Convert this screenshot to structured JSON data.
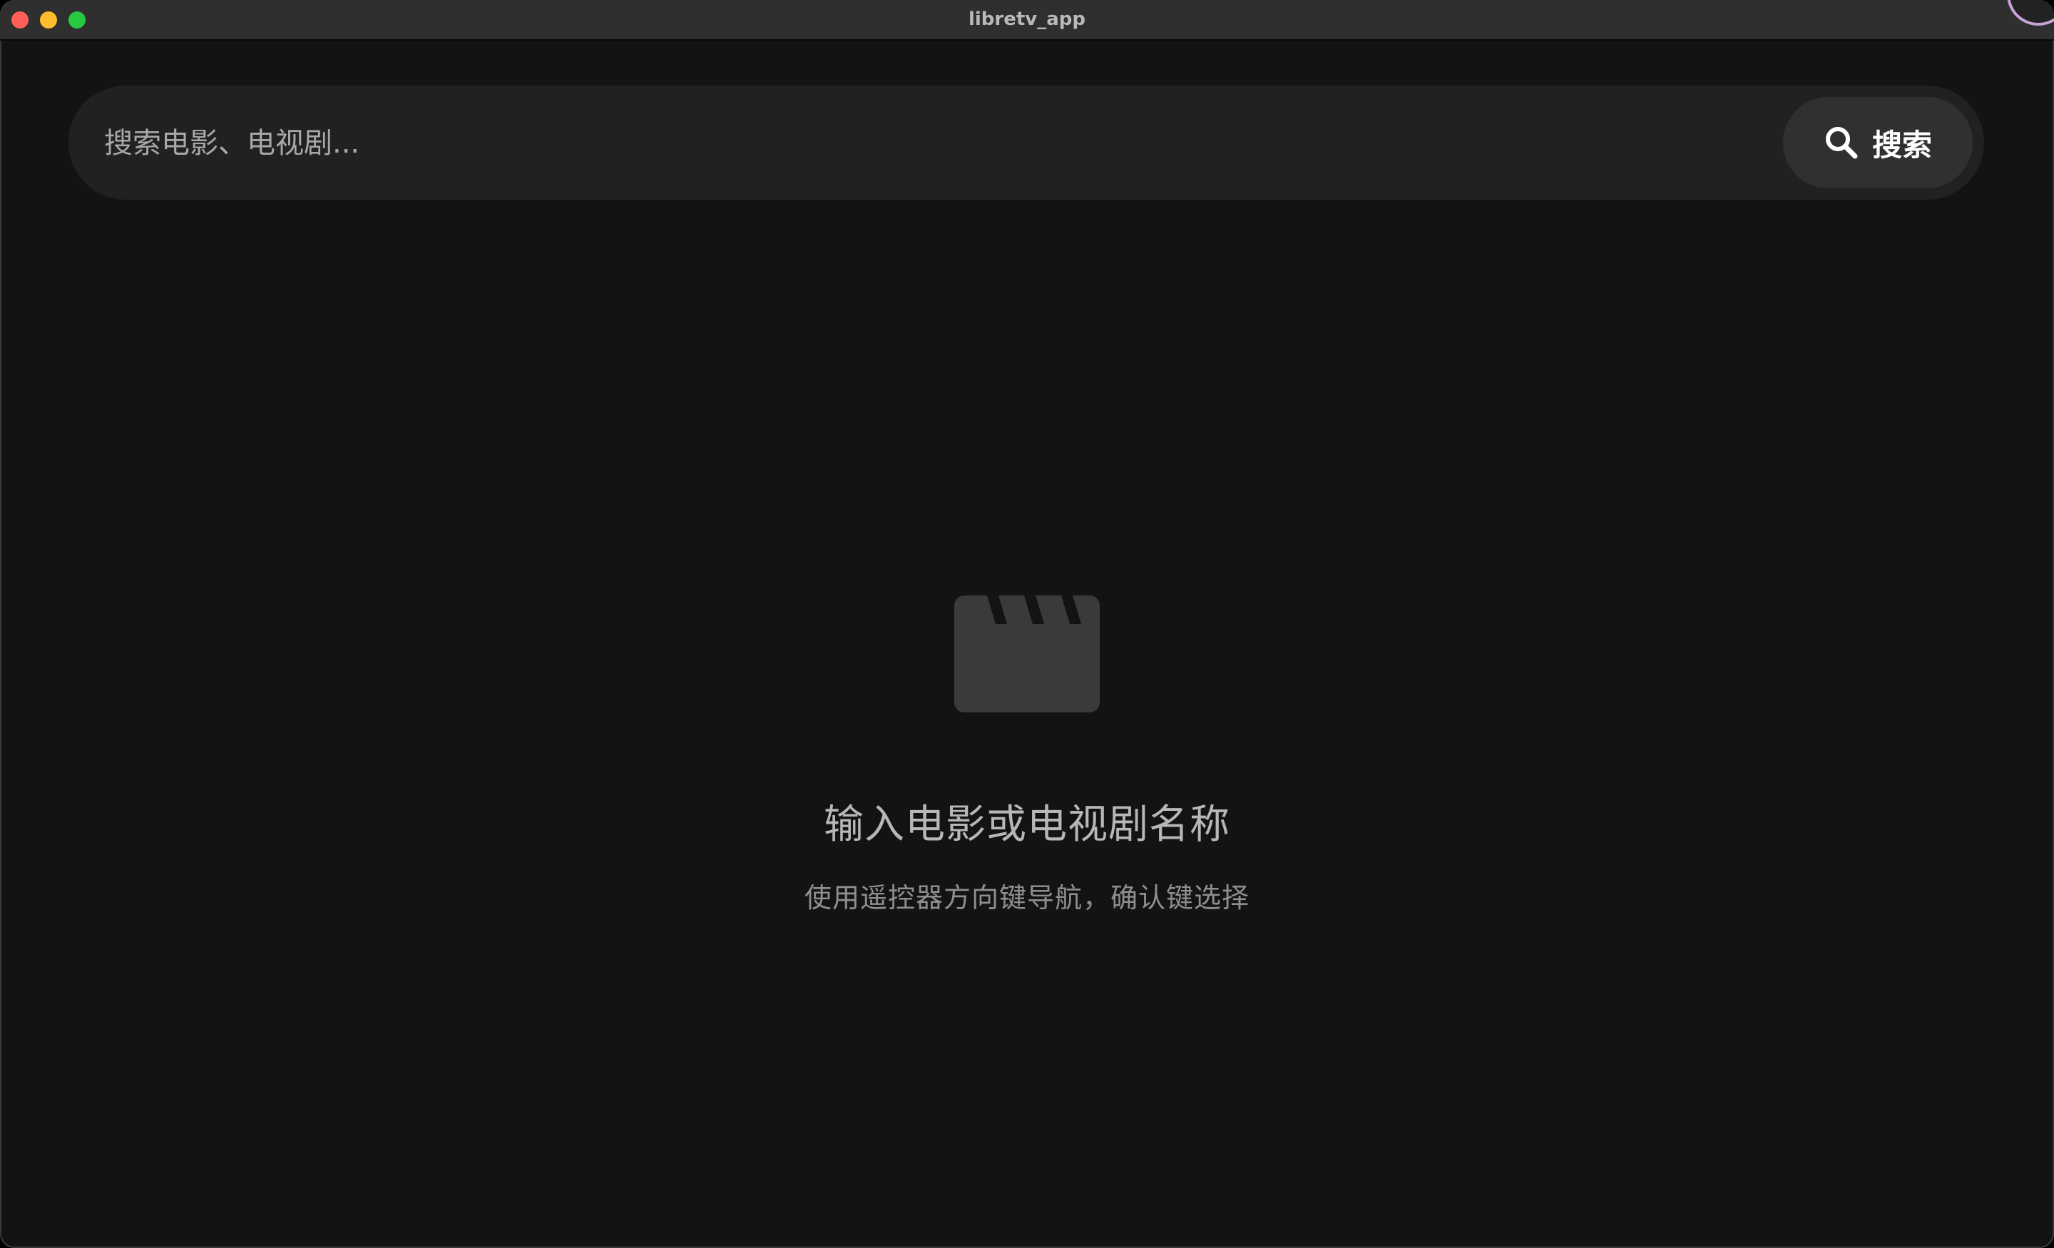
{
  "window": {
    "title": "libretv_app"
  },
  "search": {
    "placeholder": "搜索电影、电视剧...",
    "value": "",
    "button_label": "搜索",
    "button_icon": "search-icon"
  },
  "empty_state": {
    "icon": "clapperboard-icon",
    "title": "输入电影或电视剧名称",
    "subtitle": "使用遥控器方向键导航，确认键选择"
  },
  "colors": {
    "background": "#131313",
    "search_bar": "#212121",
    "search_button": "#303030",
    "icon": "#3a3a3a"
  }
}
